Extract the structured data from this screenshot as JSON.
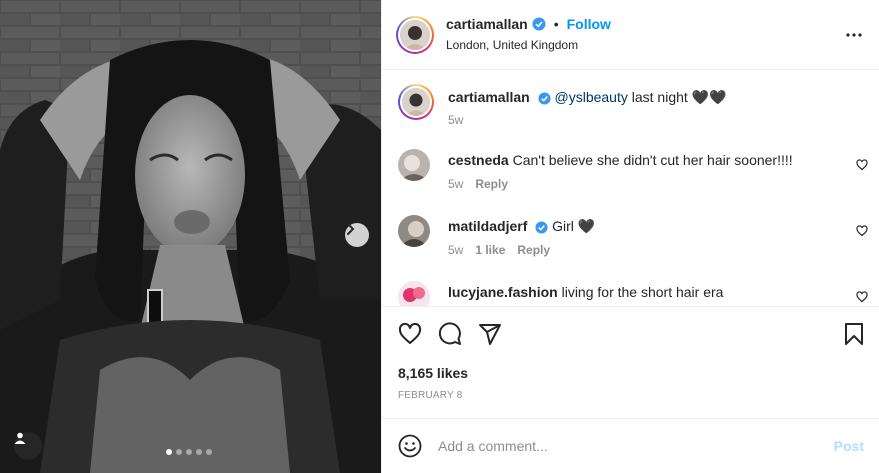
{
  "post": {
    "username": "cartiamallan",
    "verified": true,
    "follow_label": "Follow",
    "separator": "•",
    "location": "London, United Kingdom",
    "more_icon": "more-horizontal-icon"
  },
  "caption": {
    "username": "cartiamallan",
    "mention": "@yslbeauty",
    "text": " last night 🖤🖤",
    "time": "5w"
  },
  "comments": [
    {
      "username": "cestneda",
      "verified": false,
      "text": "Can't believe she didn't cut her hair sooner!!!!",
      "time": "5w",
      "likes": "",
      "reply": "Reply"
    },
    {
      "username": "matildadjerf",
      "verified": true,
      "text": "Girl 🖤",
      "time": "5w",
      "likes": "1 like",
      "reply": "Reply"
    },
    {
      "username": "lucyjane.fashion",
      "verified": false,
      "text": "living for the short hair era",
      "time": "",
      "likes": "",
      "reply": ""
    }
  ],
  "actions": {
    "like_icon": "heart-icon",
    "comment_icon": "comment-icon",
    "share_icon": "share-icon",
    "save_icon": "bookmark-icon"
  },
  "likes": "8,165 likes",
  "date": "FEBRUARY 8",
  "add_comment": {
    "placeholder": "Add a comment...",
    "post_label": "Post",
    "post_color": "#b2dffc"
  },
  "carousel": {
    "total": 5,
    "active": 0
  },
  "colors": {
    "accent": "#0095f6",
    "verified": "#3897f0",
    "mention": "#00376b",
    "muted": "#8e8e8e"
  }
}
